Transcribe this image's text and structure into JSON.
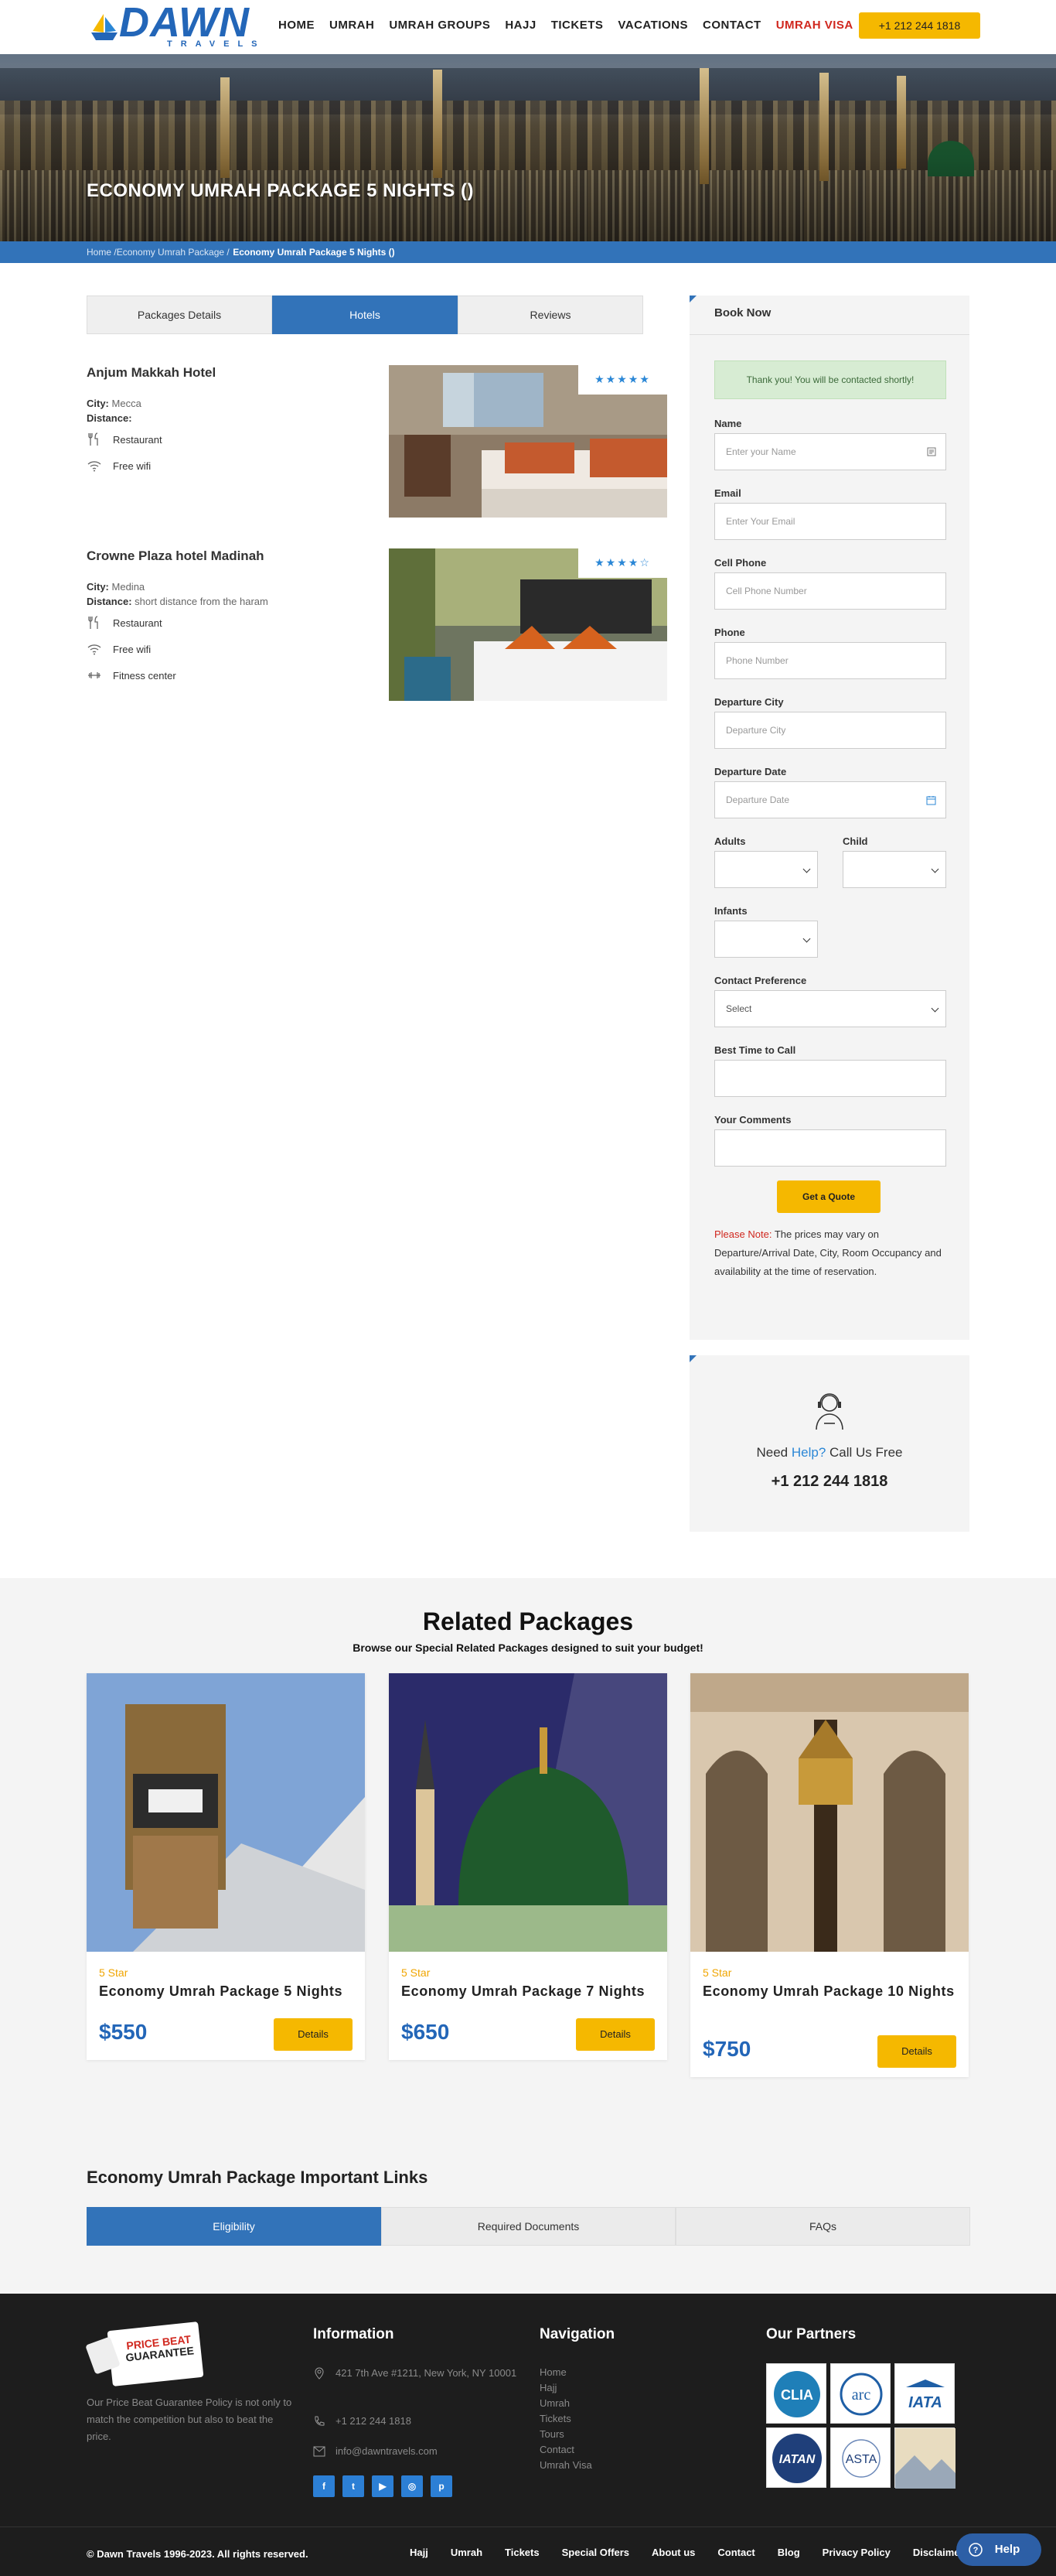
{
  "header": {
    "logo_word": "DAWN",
    "logo_sub": "TRAVELS",
    "nav": [
      "HOME",
      "UMRAH",
      "UMRAH GROUPS",
      "HAJJ",
      "TICKETS",
      "VACATIONS",
      "CONTACT",
      "UMRAH VISA"
    ],
    "phone": "+1 212 244 1818",
    "colors": {
      "brand_blue": "#2366b8",
      "accent_yellow": "#f5b800",
      "nav_red": "#d0271e"
    }
  },
  "hero": {
    "title": "ECONOMY UMRAH PACKAGE 5 NIGHTS ()",
    "breadcrumb": {
      "home": "Home",
      "sep1": " /",
      "parent": "Economy Umrah Package",
      "sep2": " /",
      "current": "Economy Umrah Package 5 Nights ()"
    }
  },
  "tabs": [
    "Packages Details",
    "Hotels",
    "Reviews"
  ],
  "hotels": [
    {
      "name": "Anjum Makkah Hotel",
      "city_label": "City:",
      "city": "Mecca",
      "distance_label": "Distance:",
      "distance": "",
      "amenities": [
        "Restaurant",
        "Free wifi"
      ],
      "stars": 5
    },
    {
      "name": "Crowne Plaza hotel Madinah",
      "city_label": "City:",
      "city": "Medina",
      "distance_label": "Distance:",
      "distance": "short distance from the haram",
      "amenities": [
        "Restaurant",
        "Free wifi",
        "Fitness center"
      ],
      "stars": 4
    }
  ],
  "booking": {
    "title": "Book Now",
    "success": "Thank you! You will be contacted shortly!",
    "name_label": "Name",
    "name_ph": "Enter your Name",
    "email_label": "Email",
    "email_ph": "Enter Your Email",
    "cell_label": "Cell Phone",
    "cell_ph": "Cell Phone Number",
    "phone_label": "Phone",
    "phone_ph": "Phone Number",
    "city_label": "Departure City",
    "city_ph": "Departure City",
    "date_label": "Departure Date",
    "date_ph": "Departure Date",
    "adults_label": "Adults",
    "child_label": "Child",
    "infants_label": "Infants",
    "contact_label": "Contact Preference",
    "contact_value": "Select",
    "time_label": "Best Time to Call",
    "comments_label": "Your Comments",
    "quote_button": "Get a Quote",
    "note_prefix": "Please Note:",
    "note_text": " The prices may vary on Departure/Arrival Date, City, Room Occupancy and availability at the time of reservation."
  },
  "help": {
    "prefix": "Need ",
    "help": "Help?",
    "suffix": " Call Us Free",
    "phone": "+1 212 244 1818"
  },
  "related": {
    "title": "Related Packages",
    "subtitle": "Browse our Special Related Packages designed to suit your budget!",
    "cards": [
      {
        "star": "5 Star",
        "name": "Economy Umrah Package 5 Nights",
        "price": "$550",
        "button": "Details"
      },
      {
        "star": "5 Star",
        "name": "Economy Umrah Package 7 Nights",
        "price": "$650",
        "button": "Details"
      },
      {
        "star": "5 Star",
        "name": "Economy Umrah Package 10 Nights",
        "price": "$750",
        "button": "Details"
      }
    ]
  },
  "links": {
    "title": "Economy Umrah Package Important Links",
    "tabs": [
      "Eligibility",
      "Required Documents",
      "FAQs"
    ]
  },
  "footer": {
    "badge_line1": "PRICE BEAT",
    "badge_line2": "GUARANTEE",
    "badge_text": "Our Price Beat Guarantee Policy is not only to match the competition but also to beat the price.",
    "info_title": "Information",
    "address": "421 7th Ave #1211, New York, NY 10001",
    "phone": "+1 212 244 1818",
    "email": "info@dawntravels.com",
    "nav_title": "Navigation",
    "nav": [
      "Home",
      "Hajj",
      "Umrah",
      "Tickets",
      "Tours",
      "Contact",
      "Umrah Visa"
    ],
    "partners_title": "Our Partners",
    "partners": [
      "CLIA",
      "arc",
      "IATA",
      "IATAN",
      "ASTA",
      ""
    ],
    "social": [
      "facebook-icon",
      "twitter-icon",
      "youtube-icon",
      "instagram-icon",
      "pinterest-icon"
    ],
    "copyright": "© Dawn Travels 1996-2023. All rights reserved.",
    "bottom_nav": [
      "Hajj",
      "Umrah",
      "Tickets",
      "Special Offers",
      "About us",
      "Contact",
      "Blog",
      "Privacy Policy",
      "Disclaimer"
    ],
    "help_button": "Help"
  }
}
